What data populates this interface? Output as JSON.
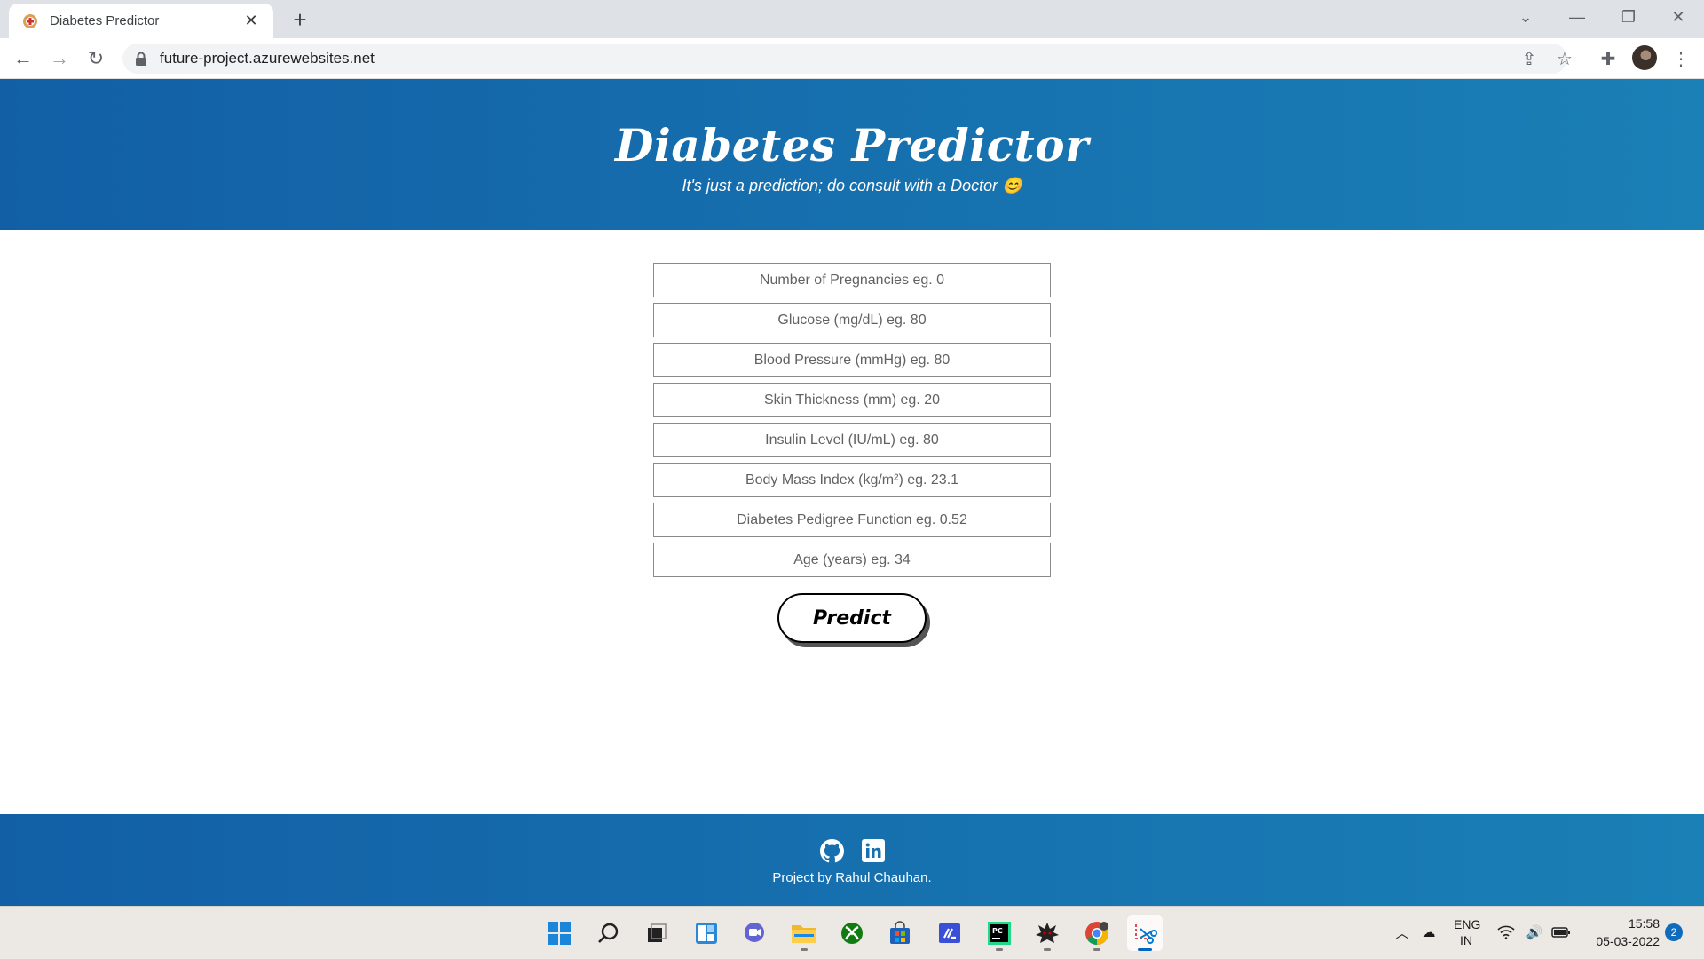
{
  "browser": {
    "tab_title": "Diabetes Predictor",
    "url": "future-project.azurewebsites.net"
  },
  "header": {
    "title": "Diabetes Predictor",
    "subtitle": "It's just a prediction; do consult with a Doctor 😊"
  },
  "form": {
    "fields": [
      {
        "placeholder": "Number of Pregnancies eg. 0",
        "value": ""
      },
      {
        "placeholder": "Glucose (mg/dL) eg. 80",
        "value": ""
      },
      {
        "placeholder": "Blood Pressure (mmHg) eg. 80",
        "value": ""
      },
      {
        "placeholder": "Skin Thickness (mm) eg. 20",
        "value": ""
      },
      {
        "placeholder": "Insulin Level (IU/mL) eg. 80",
        "value": ""
      },
      {
        "placeholder": "Body Mass Index (kg/m²) eg. 23.1",
        "value": ""
      },
      {
        "placeholder": "Diabetes Pedigree Function eg. 0.52",
        "value": ""
      },
      {
        "placeholder": "Age (years) eg. 34",
        "value": ""
      }
    ],
    "submit_label": "Predict"
  },
  "footer": {
    "credit": "Project by Rahul Chauhan.",
    "icons": [
      "github-icon",
      "linkedin-icon"
    ]
  },
  "taskbar": {
    "language_line1": "ENG",
    "language_line2": "IN",
    "time": "15:58",
    "date": "05-03-2022",
    "notification_count": "2"
  },
  "colors": {
    "header_gradient_start": "#125fa6",
    "header_gradient_end": "#1a80b6",
    "windows_accent": "#0067c0"
  }
}
